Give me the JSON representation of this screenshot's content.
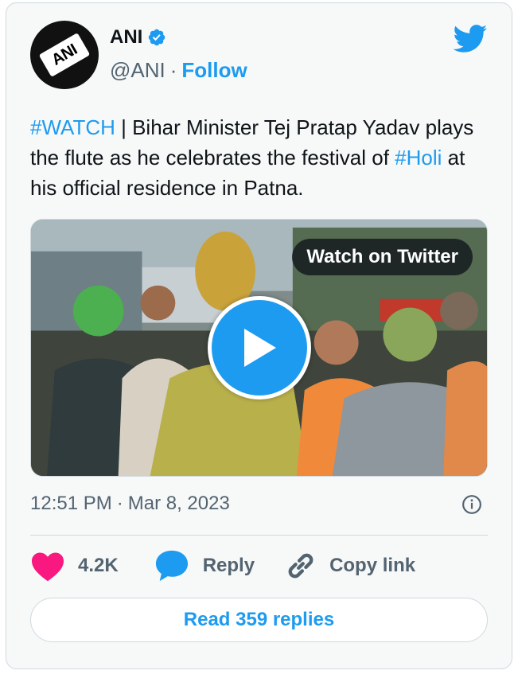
{
  "author": {
    "avatar_text": "ANI",
    "name": "ANI",
    "handle": "@ANI",
    "separator": "·",
    "follow_label": "Follow"
  },
  "tweet": {
    "hashtag1": "#WATCH",
    "text1": " | Bihar Minister Tej Pratap Yadav plays the flute as he celebrates the festival of ",
    "hashtag2": "#Holi",
    "text2": " at his official residence in Patna."
  },
  "media": {
    "watch_label": "Watch on Twitter"
  },
  "meta": {
    "time": "12:51 PM",
    "separator": "·",
    "date": "Mar 8, 2023"
  },
  "actions": {
    "like_count": "4.2K",
    "reply_label": "Reply",
    "copy_label": "Copy link"
  },
  "read_replies_label": "Read 359 replies",
  "icons": {
    "verified": "verified-badge-icon",
    "twitter": "twitter-bird-icon",
    "play": "play-icon",
    "info": "info-icon",
    "like": "heart-icon",
    "reply": "speech-bubble-icon",
    "copy": "link-icon"
  },
  "colors": {
    "accent": "#1d9bf0",
    "like": "#f91880",
    "muted": "#536471",
    "text": "#0f1419",
    "border": "#cfd9de"
  }
}
